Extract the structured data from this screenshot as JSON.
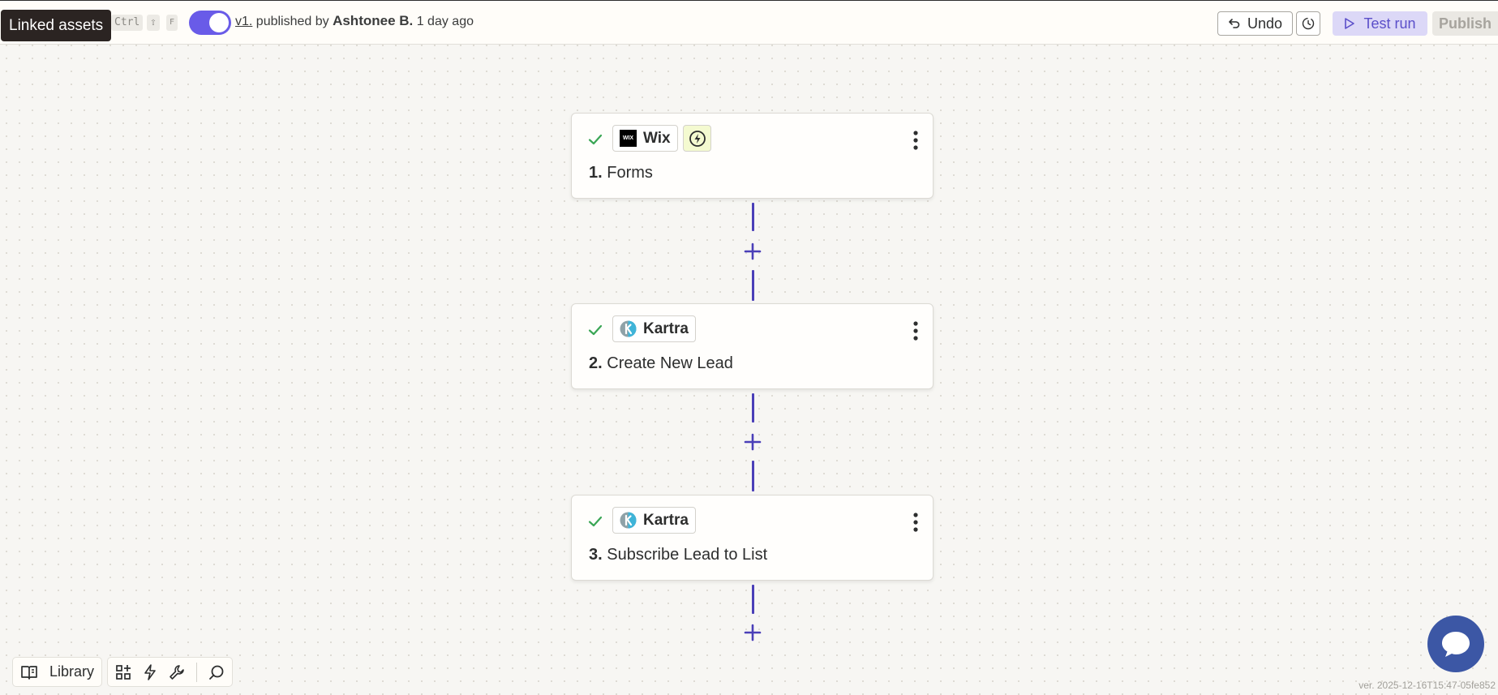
{
  "tooltip": {
    "label": "Linked assets"
  },
  "shortcut": {
    "key1": "Ctrl",
    "key2": "⇧",
    "key3": "F"
  },
  "header": {
    "version_link": "v1.",
    "published_by": " published by ",
    "author": "Ashtonee B.",
    "when": " 1 day ago",
    "undo_label": "Undo",
    "test_run_label": "Test run",
    "publish_label": "Publish"
  },
  "steps": [
    {
      "number": "1.",
      "title": "Forms",
      "app": "Wix",
      "app_icon": "wix-logo",
      "has_trigger_badge": true
    },
    {
      "number": "2.",
      "title": "Create New Lead",
      "app": "Kartra",
      "app_icon": "kartra-logo"
    },
    {
      "number": "3.",
      "title": "Subscribe Lead to List",
      "app": "Kartra",
      "app_icon": "kartra-logo"
    }
  ],
  "toolbar": {
    "library_label": "Library"
  },
  "footer": {
    "build_version": "ver. 2025-12-16T15:47-05fe852"
  },
  "colors": {
    "accent": "#695be8",
    "connector": "#4a3fb8",
    "check": "#3aa655",
    "chat": "#3c57a5"
  }
}
